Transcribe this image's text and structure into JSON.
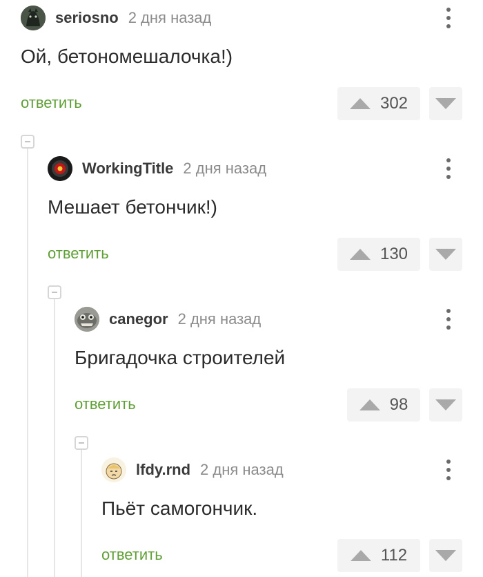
{
  "comments": [
    {
      "username": "seriosno",
      "timestamp": "2 дня назад",
      "text": "Ой, бетономешалочка!)",
      "reply_label": "ответить",
      "rating": "302",
      "avatar_icon": "dark-creature-avatar"
    },
    {
      "username": "WorkingTitle",
      "timestamp": "2 дня назад",
      "text": "Мешает бетончик!)",
      "reply_label": "ответить",
      "rating": "130",
      "avatar_icon": "red-eye-avatar"
    },
    {
      "username": "canegor",
      "timestamp": "2 дня назад",
      "text": "Бригадочка строителей",
      "reply_label": "ответить",
      "rating": "98",
      "avatar_icon": "grey-creature-avatar"
    },
    {
      "username": "lfdy.rnd",
      "timestamp": "2 дня назад",
      "text": "Пьёт самогончик.",
      "reply_label": "ответить",
      "rating": "112",
      "avatar_icon": "cartoon-face-avatar"
    }
  ],
  "colors": {
    "accent": "#5f9f35",
    "muted": "#8b8b8b",
    "vote_bg": "#f3f3f3"
  }
}
